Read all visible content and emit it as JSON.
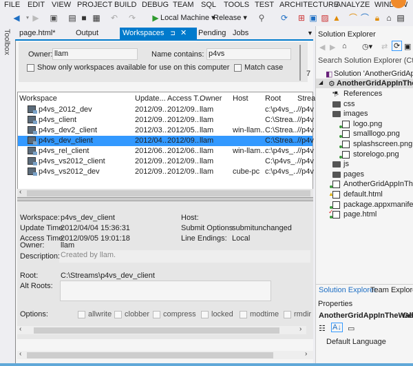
{
  "menu": [
    "FILE",
    "EDIT",
    "VIEW",
    "PROJECT",
    "BUILD",
    "DEBUG",
    "TEAM",
    "SQL",
    "TOOLS",
    "TEST",
    "ARCHITECTURE",
    "ANALYZE",
    "WINDOW"
  ],
  "toolbar": {
    "target": "Local Machine",
    "config": "Release"
  },
  "toolbox_label": "Toolbox",
  "doc_tabs": [
    {
      "label": "page.html*"
    },
    {
      "label": "Output"
    },
    {
      "label": "Workspaces",
      "active": true
    },
    {
      "label": "Pending"
    },
    {
      "label": "Jobs"
    }
  ],
  "filter": {
    "owner_label": "Owner:",
    "owner_value": "llam",
    "name_label": "Name contains:",
    "name_value": "p4vs",
    "show_only_label": "Show only workspaces available for use on this computer",
    "match_case_label": "Match case",
    "count": "7"
  },
  "grid": {
    "columns": [
      "Workspace",
      "Update...",
      "Access T...",
      "Owner",
      "Host",
      "Root",
      "Strea"
    ],
    "rows": [
      [
        "p4vs_2012_dev",
        "2012/09...",
        "2012/09...",
        "llam",
        "",
        "c:\\p4vs_...",
        "//p4v"
      ],
      [
        "p4vs_client",
        "2012/09...",
        "2012/09...",
        "llam",
        "",
        "C:\\Strea...",
        "//p4v"
      ],
      [
        "p4vs_dev2_client",
        "2012/03...",
        "2012/05...",
        "llam",
        "win-llam...",
        "C:\\Strea...",
        "//p4v"
      ],
      [
        "p4vs_dev_client",
        "2012/04...",
        "2012/09...",
        "llam",
        "",
        "C:\\Strea...",
        "//p4v"
      ],
      [
        "p4vs_rel_client",
        "2012/06...",
        "2012/06...",
        "llam",
        "win-llam...",
        "c:\\p4vs_...",
        "//p4v"
      ],
      [
        "p4vs_vs2012_client",
        "2012/09...",
        "2012/09...",
        "llam",
        "",
        "C:\\p4vs_...",
        "//p4v"
      ],
      [
        "p4vs_vs2012_dev",
        "2012/09...",
        "2012/09...",
        "llam",
        "cube-pc",
        "c:\\p4vs_...",
        "//p4v"
      ]
    ],
    "selected_index": 3
  },
  "details": {
    "workspace_label": "Workspace:",
    "workspace": "p4vs_dev_client",
    "update_label": "Update Time:",
    "update": "2012/04/04 15:36:31",
    "access_label": "Access Time:",
    "access": "2012/09/05 19:01:18",
    "owner_label": "Owner:",
    "owner": "llam",
    "host_label": "Host:",
    "host": "",
    "submit_label": "Submit Options",
    "submit": "submitunchanged",
    "line_label": "Line Endings:",
    "line": "Local",
    "desc_label": "Description:",
    "desc": "Created by llam.",
    "root_label": "Root:",
    "root": "C:\\Streams\\p4vs_dev_client",
    "alt_label": "Alt Roots:",
    "alt": "",
    "options_label": "Options:",
    "options": [
      "allwrite",
      "clobber",
      "compress",
      "locked",
      "modtime",
      "rmdir"
    ]
  },
  "solution_explorer": {
    "title": "Solution Explorer",
    "search_placeholder": "Search Solution Explorer (Ctrl+;)",
    "solution": "Solution 'AnotherGridAppIn",
    "project": "AnotherGridAppInTheW",
    "items": [
      "References",
      "css",
      "images",
      "logo.png",
      "smalllogo.png",
      "splashscreen.png",
      "storelogo.png",
      "js",
      "pages",
      "AnotherGridAppInTh",
      "default.html",
      "package.appxmanife",
      "page.html"
    ],
    "tabs": [
      "Solution Explorer",
      "Team Explorer"
    ]
  },
  "properties": {
    "title": "Properties",
    "object": "AnotherGridAppInTheWall",
    "object_type": "Gen",
    "row": "Default Language"
  }
}
